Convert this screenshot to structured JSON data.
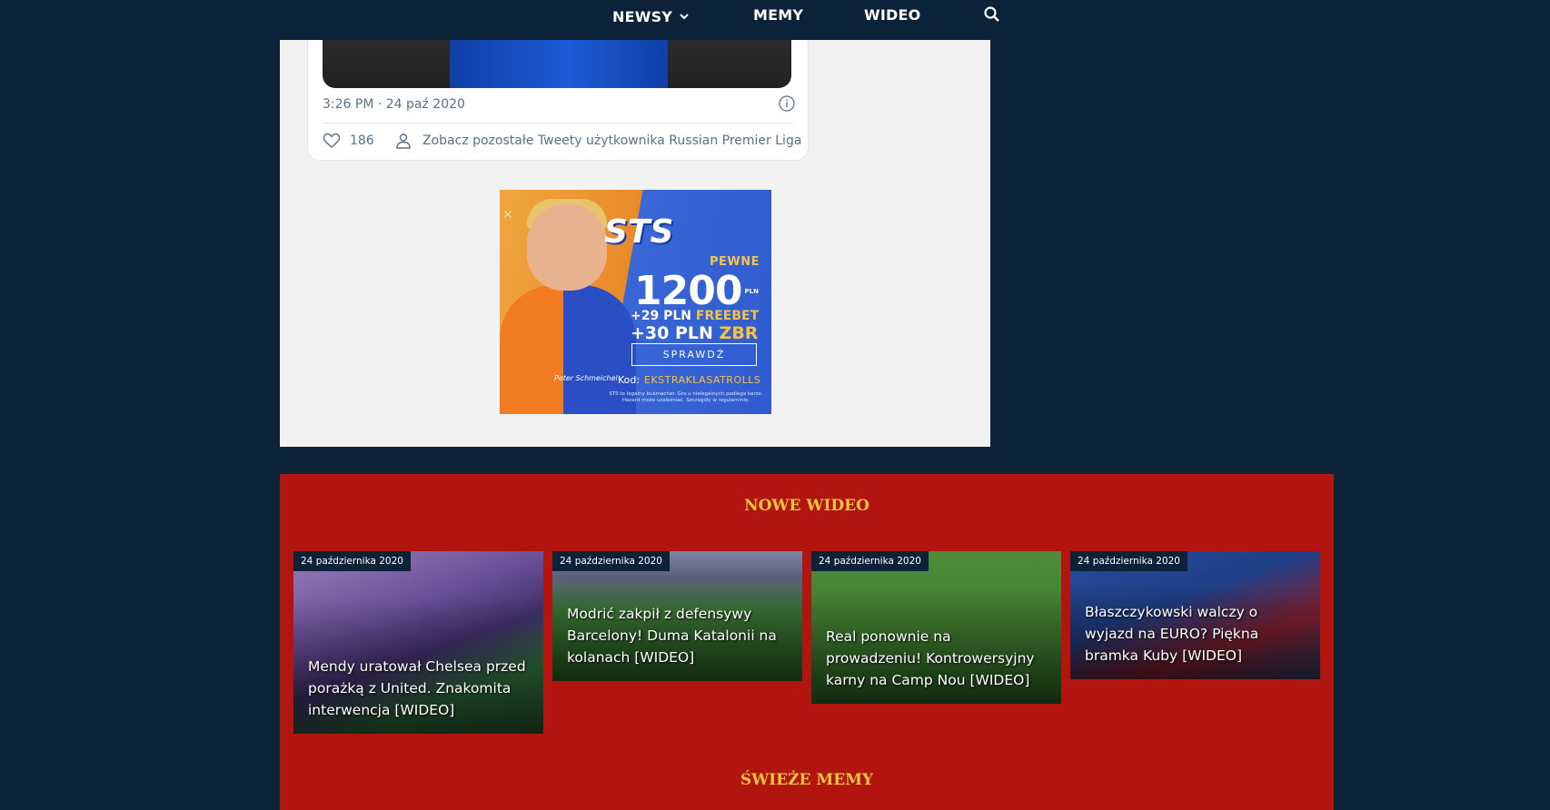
{
  "nav": {
    "items": [
      "NEWSY",
      "MEMY",
      "WIDEO"
    ]
  },
  "tweet": {
    "timestamp": "3:26 PM · 24 paź 2020",
    "likes": "186",
    "more_link": "Zobacz pozostałe Tweety użytkownika Russian Premier Liga"
  },
  "ad": {
    "brand": "STS",
    "pewne": "PEWNE",
    "amount": "1200",
    "currency": "PLN",
    "freebet_amount": "+29 PLN",
    "freebet_label": "FREEBET",
    "zbr_amount": "+30 PLN",
    "zbr_label": "ZBR",
    "button": "SPRAWDŹ",
    "code_label": "Kod:",
    "code": "EKSTRAKLASATROLLS",
    "signature": "Peter Schmeichel",
    "fine_print": "STS to legalny bukmacher. Gra u nielegalnych podlega karze. Hazard może uzależniać. Szczegóły w regulaminie."
  },
  "sections": {
    "videos_title": "NOWE WIDEO",
    "memes_title": "ŚWIEŻE MEMY"
  },
  "videos": [
    {
      "date": "24 października 2020",
      "title": "Mendy uratował Chelsea przed porażką z United. Znakomita interwencja [WIDEO]"
    },
    {
      "date": "24 października 2020",
      "title": "Modrić zakpił z defensywy Barcelony! Duma Katalonii na kolanach [WIDEO]"
    },
    {
      "date": "24 października 2020",
      "title": "Real ponownie na prowadzeniu! Kontrowersyjny karny na Camp Nou [WIDEO]"
    },
    {
      "date": "24 października 2020",
      "title": "Błaszczykowski walczy o wyjazd na EURO? Piękna bramka Kuby [WIDEO]"
    }
  ],
  "colors": {
    "navy": "#0b2238",
    "red": "#b21410",
    "gold": "#f5c53a"
  }
}
